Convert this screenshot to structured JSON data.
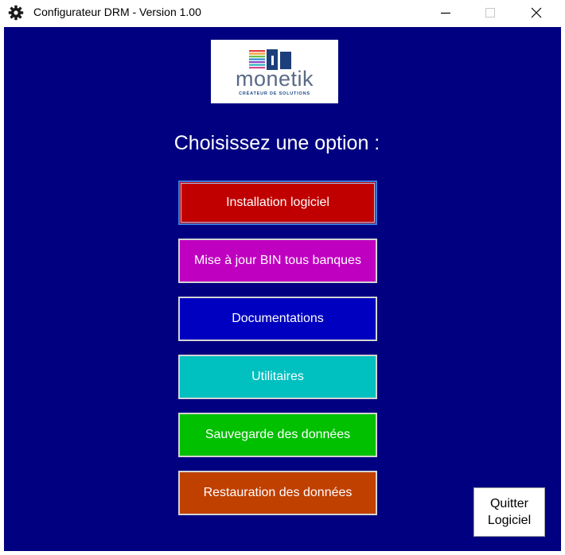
{
  "window": {
    "title": "Configurateur DRM - Version 1.00",
    "icon": "gear-icon",
    "controls": [
      "minimize-icon",
      "maximize-icon",
      "close-icon"
    ]
  },
  "logo": {
    "word": "monetik",
    "tagline": "CRÉATEUR DE SOLUTIONS"
  },
  "main": {
    "heading": "Choisissez une option :",
    "options": [
      {
        "label": "Installation logiciel",
        "color": "#c00000"
      },
      {
        "label": "Mise à jour BIN tous banques",
        "color": "#c000c0"
      },
      {
        "label": "Documentations",
        "color": "#0000c0"
      },
      {
        "label": "Utilitaires",
        "color": "#00c0c0"
      },
      {
        "label": "Sauvegarde des données",
        "color": "#00c000"
      },
      {
        "label": "Restauration des données",
        "color": "#c04000"
      }
    ],
    "quit_line1": "Quitter",
    "quit_line2": "Logiciel"
  },
  "colors": {
    "background": "#000080",
    "option_border": "#d4d4d4"
  }
}
